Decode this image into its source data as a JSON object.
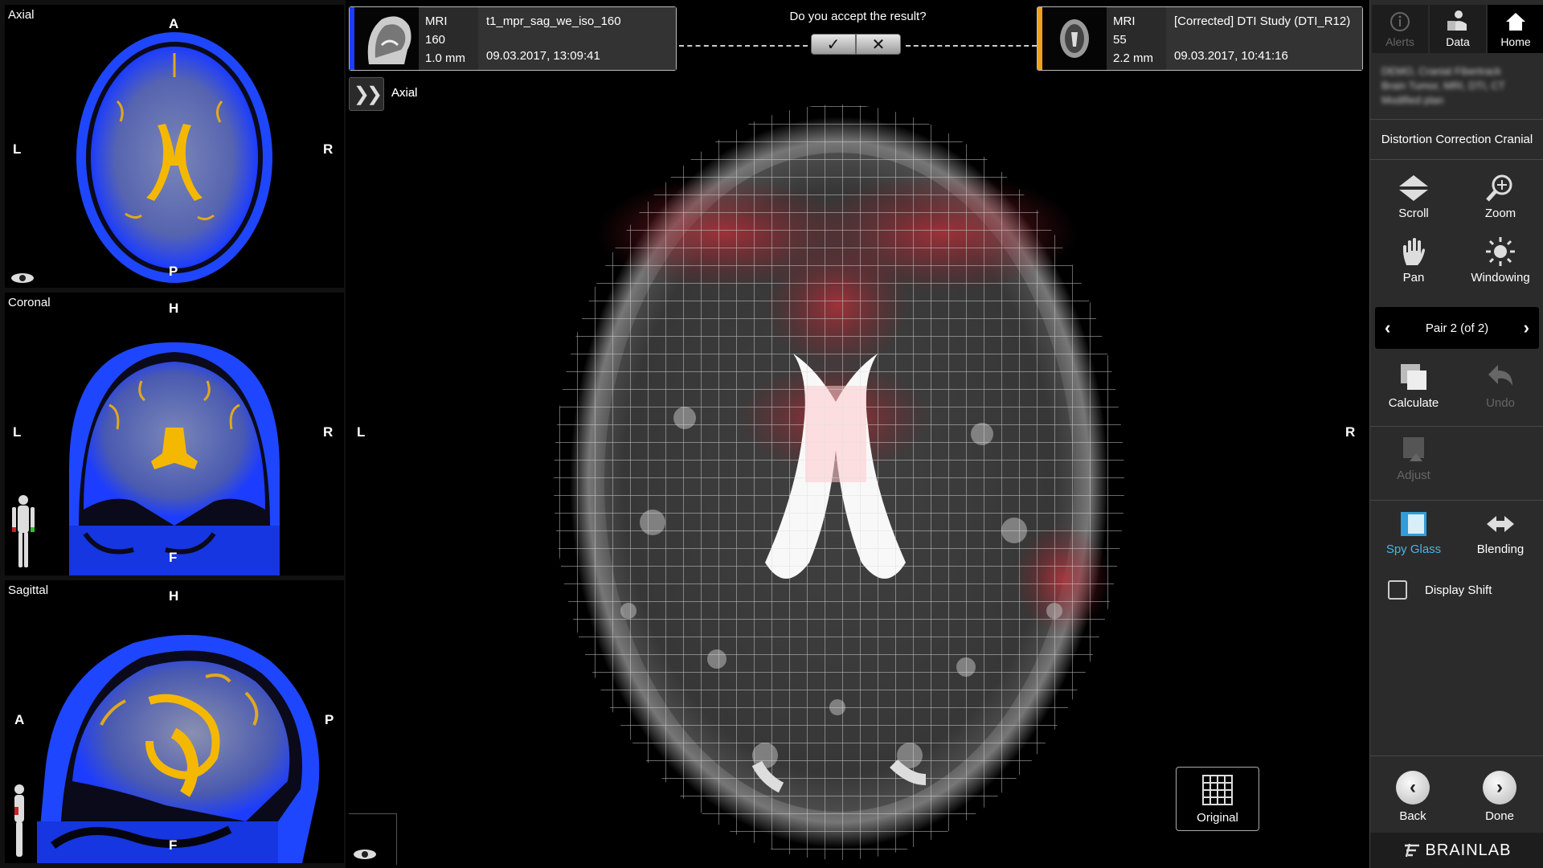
{
  "views": {
    "axial": {
      "title": "Axial",
      "top": "A",
      "bottom": "P",
      "left": "L",
      "right": "R"
    },
    "coronal": {
      "title": "Coronal",
      "top": "H",
      "bottom": "F",
      "left": "L",
      "right": "R"
    },
    "sagittal": {
      "title": "Sagittal",
      "top": "H",
      "bottom": "F",
      "left": "A",
      "right": "P"
    }
  },
  "series_left": {
    "modality": "MRI",
    "slices": "160",
    "thickness": "1.0 mm",
    "name": "t1_mpr_sag_we_iso_160",
    "date": "09.03.2017, 13:09:41",
    "accent": "#1e3cff"
  },
  "series_right": {
    "modality": "MRI",
    "slices": "55",
    "thickness": "2.2 mm",
    "name": "[Corrected] DTI Study (DTI_R12)",
    "date": "09.03.2017, 10:41:16",
    "accent": "#f0a020"
  },
  "accept": {
    "question": "Do you accept the result?",
    "yes_icon": "✓",
    "no_icon": "✕"
  },
  "main_view": {
    "title": "Axial",
    "left": "L",
    "right": "R",
    "original_label": "Original"
  },
  "right_panel": {
    "alerts_label": "Alerts",
    "data_label": "Data",
    "home_label": "Home",
    "patient_info": [
      "DEMO, Cranial Fibertrack",
      "Brain Tumor, MRI, DTI, CT",
      "Modified plan"
    ],
    "step_title": "Distortion Correction Cranial",
    "tools": {
      "scroll": "Scroll",
      "zoom": "Zoom",
      "pan": "Pan",
      "windowing": "Windowing",
      "calculate": "Calculate",
      "undo": "Undo",
      "adjust": "Adjust",
      "spy_glass": "Spy Glass",
      "blending": "Blending"
    },
    "pair_label": "Pair 2 (of 2)",
    "display_shift_label": "Display Shift",
    "back_label": "Back",
    "done_label": "Done",
    "brand": "BRAINLAB"
  }
}
